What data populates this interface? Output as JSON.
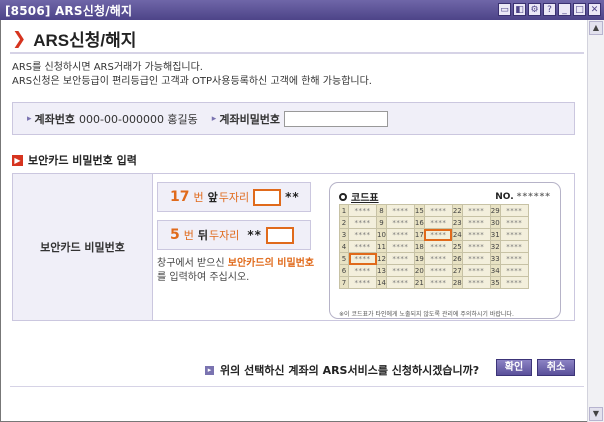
{
  "window": {
    "title": "[8506] ARS신청/해지",
    "controls": [
      "▭",
      "◧",
      "⚙",
      "?",
      "_",
      "□",
      "✕"
    ]
  },
  "page": {
    "title": "ARS신청/해지",
    "desc_line1": "ARS를 신청하시면 ARS거래가 가능해집니다.",
    "desc_line2": "ARS신청은 보안등급이 편리등급인 고객과 OTP사용등록하신 고객에 한해 가능합니다."
  },
  "account": {
    "number_label": "계좌번호",
    "number_value": "000-00-000000 홍길동",
    "password_label": "계좌비밀번호",
    "password_value": ""
  },
  "security": {
    "section_title": "보안카드 비밀번호 입력",
    "left_label": "보안카드 비밀번호",
    "first": {
      "num": "17",
      "w1": "번",
      "w2": "앞",
      "w3": "두자리",
      "stars": "**"
    },
    "second": {
      "num": "5",
      "w1": "번",
      "w2": "뒤",
      "w3": "두자리",
      "stars": "**"
    },
    "guide_pre": "창구에서 받으신 ",
    "guide_hl": "보안카드의 비밀번호",
    "guide_post": "를 입력하여 주십시오."
  },
  "card": {
    "title": "코드표",
    "no_label": "NO.",
    "no_value": "******",
    "cell_value": "****",
    "rows": [
      [
        "1",
        "8",
        "15",
        "22",
        "29"
      ],
      [
        "2",
        "9",
        "16",
        "23",
        "30"
      ],
      [
        "3",
        "10",
        "17",
        "24",
        "31"
      ],
      [
        "4",
        "11",
        "18",
        "25",
        "32"
      ],
      [
        "5",
        "12",
        "19",
        "26",
        "33"
      ],
      [
        "6",
        "13",
        "20",
        "27",
        "34"
      ],
      [
        "7",
        "14",
        "21",
        "28",
        "35"
      ]
    ],
    "note": "※이 코드표가 타인에게 노출되지 않도록 관리에 주의하시기 바랍니다."
  },
  "confirm": {
    "question": "위의 선택하신 계좌의 ARS서비스를 신청하시겠습니까?",
    "ok": "확인",
    "cancel": "취소"
  },
  "colors": {
    "accent": "#e06a1b",
    "title_mark": "#d6341f",
    "brand": "#5a509a"
  }
}
